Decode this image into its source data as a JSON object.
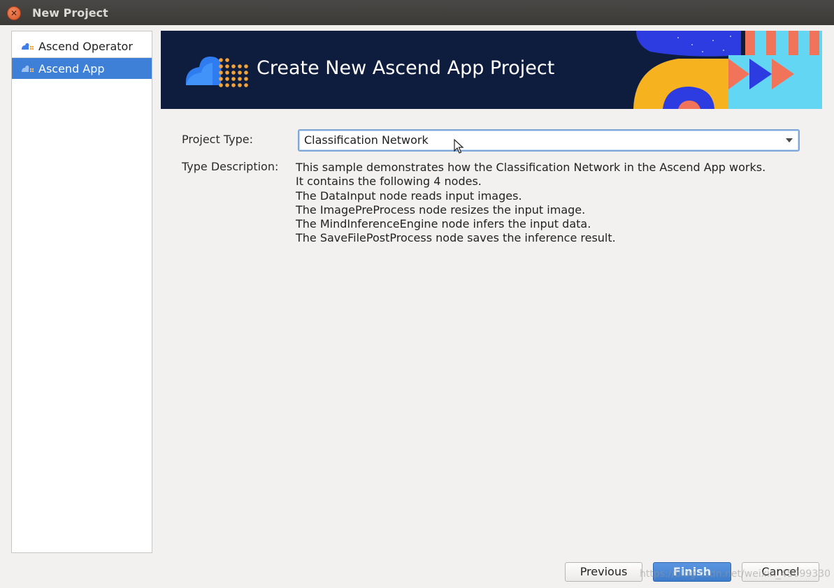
{
  "window": {
    "title": "New Project"
  },
  "sidebar": {
    "items": [
      {
        "label": "Ascend Operator",
        "icon": "ascend-logo-icon",
        "selected": false
      },
      {
        "label": "Ascend App",
        "icon": "ascend-logo-icon",
        "selected": true
      }
    ]
  },
  "banner": {
    "title": "Create New Ascend App Project"
  },
  "form": {
    "project_type_label": "Project Type:",
    "project_type_value": "Classification Network",
    "type_description_label": "Type Description:",
    "description_lines": [
      "This sample demonstrates how the Classification Network in the Ascend App works.",
      "It contains the following 4 nodes.",
      "The DataInput node reads input images.",
      "The ImagePreProcess node resizes the input image.",
      "The MindInferenceEngine node infers the input data.",
      "The SaveFilePostProcess node saves the inference result."
    ]
  },
  "buttons": {
    "previous": "Previous",
    "finish": "Finish",
    "cancel": "Cancel"
  },
  "watermark": "https://blog.csdn.net/weixin_45099330",
  "colors": {
    "selection": "#3e80d8",
    "banner_bg": "#0e1c3d",
    "accent_orange": "#f0735a",
    "accent_blue": "#2c3ce0",
    "accent_yellow": "#f7b21f"
  }
}
